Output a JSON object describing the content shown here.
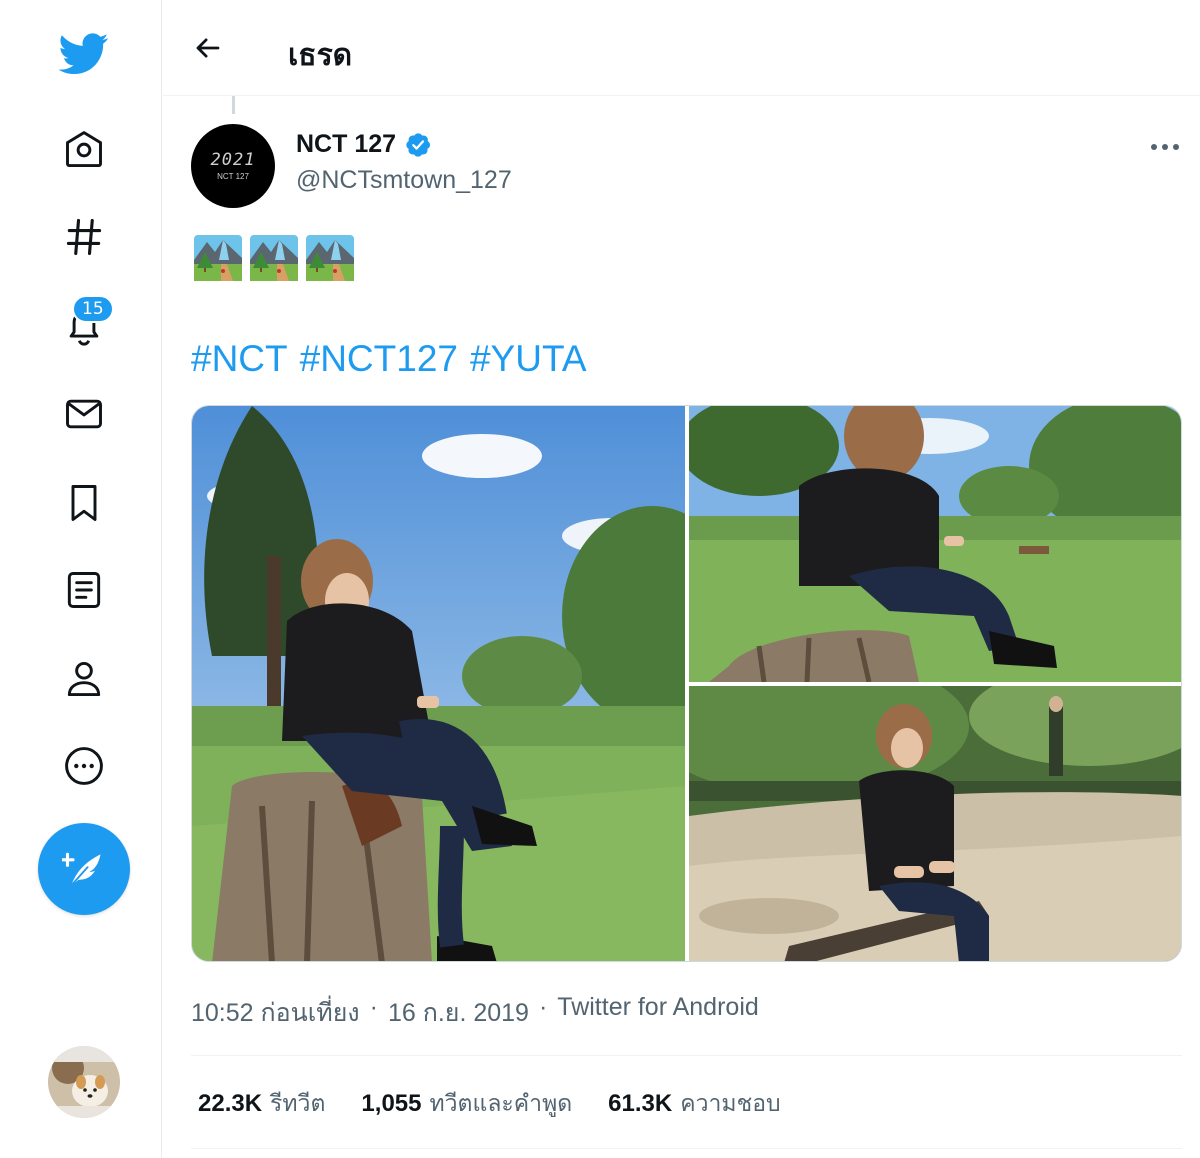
{
  "colors": {
    "accent": "#1d9bf0",
    "text_primary": "#0f1419",
    "text_secondary": "#536471",
    "border": "#eff3f4"
  },
  "sidebar": {
    "items": [
      {
        "icon": "twitter-bird-icon"
      },
      {
        "icon": "home-icon"
      },
      {
        "icon": "hashtag-icon"
      },
      {
        "icon": "bell-icon",
        "badge": "15"
      },
      {
        "icon": "mail-icon"
      },
      {
        "icon": "bookmark-icon"
      },
      {
        "icon": "list-icon"
      },
      {
        "icon": "profile-icon"
      },
      {
        "icon": "more-circle-icon"
      }
    ],
    "compose_icon": "feather-plus-icon"
  },
  "header": {
    "title": "เธรด",
    "back_icon": "arrow-left-icon"
  },
  "tweet": {
    "author_name": "NCT 127",
    "author_handle": "@NCTsmtown_127",
    "avatar_mark": "2021",
    "avatar_sub": "NCT 127",
    "verified_icon": "verified-badge-icon",
    "emoji": [
      "national-park-emoji",
      "national-park-emoji",
      "national-park-emoji"
    ],
    "hashtags": [
      "#NCT",
      "#NCT127",
      "#YUTA"
    ],
    "photos": [
      {
        "name": "photo-1",
        "description": "sitting-on-stump-wide"
      },
      {
        "name": "photo-2",
        "description": "sitting-on-stump-close"
      },
      {
        "name": "photo-3",
        "description": "sitting-on-bench"
      }
    ],
    "time": "10:52 ก่อนเที่ยง",
    "date": "16 ก.ย. 2019",
    "source": "Twitter for Android",
    "separator": "·",
    "stats": {
      "retweets_count": "22.3K",
      "retweets_label": "รีทวีต",
      "quotes_count": "1,055",
      "quotes_label": "ทวีตและคำพูด",
      "likes_count": "61.3K",
      "likes_label": "ความชอบ"
    }
  }
}
